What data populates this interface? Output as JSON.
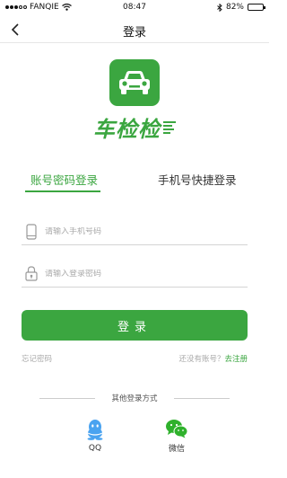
{
  "status_bar": {
    "carrier": "FANQIE",
    "time": "08:47",
    "battery_text": "82%",
    "battery_level": 0.82
  },
  "nav": {
    "title": "登录"
  },
  "logo": {
    "text": "车检检"
  },
  "tabs": [
    {
      "label": "账号密码登录",
      "active": true
    },
    {
      "label": "手机号快捷登录",
      "active": false
    }
  ],
  "form": {
    "phone_placeholder": "请输入手机号码",
    "password_placeholder": "请输入登录密码",
    "login_label": "登录"
  },
  "links": {
    "forgot": "忘记密码",
    "no_account": "还没有账号？",
    "register": "去注册"
  },
  "other_login": {
    "title": "其他登录方式",
    "options": [
      {
        "label": "QQ"
      },
      {
        "label": "微信"
      }
    ]
  },
  "colors": {
    "brand_green": "#3ba640",
    "qq_blue": "#4aa3f0",
    "wechat_green": "#2fb12c"
  }
}
